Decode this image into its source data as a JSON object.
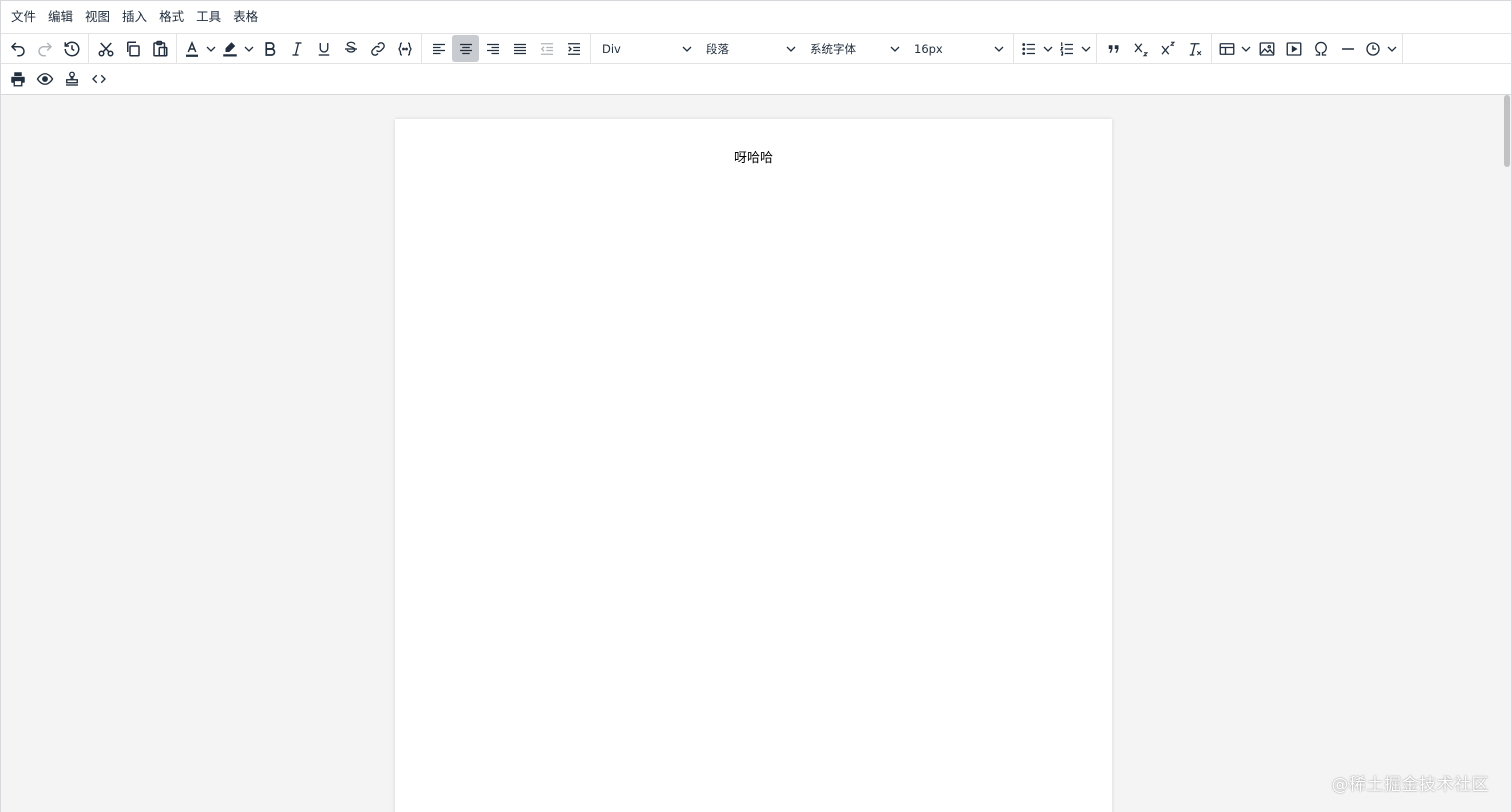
{
  "menubar": {
    "items": [
      "文件",
      "编辑",
      "视图",
      "插入",
      "格式",
      "工具",
      "表格"
    ]
  },
  "toolbar": {
    "block_select": "Div",
    "paragraph_select": "段落",
    "font_select": "系统字体",
    "size_select": "16px",
    "active_button": "align-center"
  },
  "document": {
    "text": "呀哈哈"
  },
  "watermark": "@稀土掘金技术社区",
  "icons": {
    "undo": "undo-icon",
    "redo": "redo-icon",
    "history": "history-icon",
    "cut": "cut-icon",
    "copy": "copy-icon",
    "paste": "paste-icon",
    "forecolor": "text-color-icon",
    "backcolor": "highlight-icon",
    "bold": "bold-icon",
    "italic": "italic-icon",
    "underline": "underline-icon",
    "strike": "strikethrough-icon",
    "link": "link-icon",
    "code": "code-sample-icon",
    "print": "print-icon",
    "preview": "preview-icon",
    "stamp": "stamp-icon",
    "source": "source-code-icon"
  },
  "colors": {
    "accent_active": "#c8cbcf",
    "canvas": "#f4f4f4",
    "text": "#222f3e"
  }
}
